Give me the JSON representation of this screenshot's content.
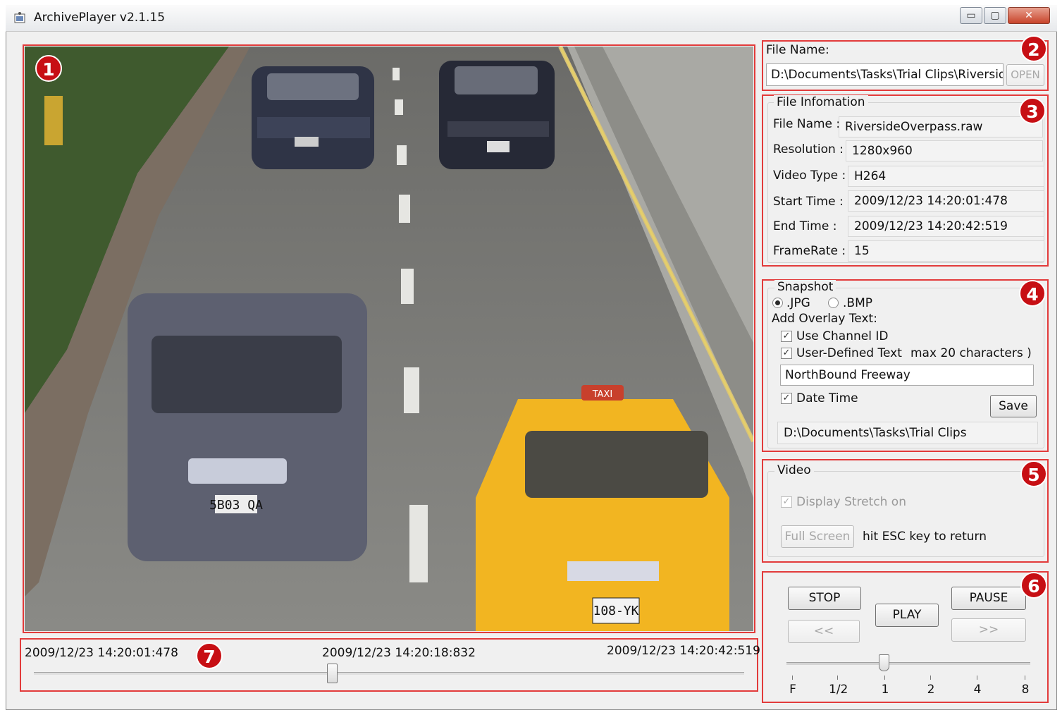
{
  "window": {
    "title": "ArchivePlayer v2.1.15"
  },
  "badges": [
    "1",
    "2",
    "3",
    "4",
    "5",
    "6",
    "7"
  ],
  "file_name": {
    "label": "File Name:",
    "value": "D:\\Documents\\Tasks\\Trial Clips\\RiversideC",
    "open_button": "OPEN"
  },
  "file_info": {
    "title": "File Infomation",
    "rows": [
      {
        "label": "File Name :",
        "value": "RiversideOverpass.raw"
      },
      {
        "label": "Resolution :",
        "value": "1280x960"
      },
      {
        "label": "Video Type :",
        "value": "H264"
      },
      {
        "label": "Start Time :",
        "value": "2009/12/23 14:20:01:478"
      },
      {
        "label": "End Time :",
        "value": "2009/12/23 14:20:42:519"
      },
      {
        "label": "FrameRate :",
        "value": "15"
      }
    ]
  },
  "snapshot": {
    "title": "Snapshot",
    "format_jpg": ".JPG",
    "format_bmp": ".BMP",
    "selected_format": "JPG",
    "overlay_label": "Add Overlay Text:",
    "use_channel_id": "Use Channel ID",
    "user_defined_text": "User-Defined Text",
    "max_chars_note": "max 20 characters )",
    "overlay_value": "NorthBound Freeway",
    "date_time": "Date Time",
    "save_button": "Save",
    "save_path": "D:\\Documents\\Tasks\\Trial Clips"
  },
  "video": {
    "title": "Video",
    "display_stretch": "Display Stretch on",
    "full_screen_button": "Full Screen",
    "esc_hint": "hit ESC key to return"
  },
  "playback": {
    "stop": "STOP",
    "play": "PLAY",
    "pause": "PAUSE",
    "rewind": "<<",
    "forward": ">>",
    "speed_labels": [
      "F",
      "1/2",
      "1",
      "2",
      "4",
      "8"
    ],
    "selected_speed": "1"
  },
  "timeline": {
    "start": "2009/12/23 14:20:01:478",
    "current": "2009/12/23 14:20:18:832",
    "end": "2009/12/23 14:20:42:519",
    "position_fraction": 0.42
  },
  "video_frame": {
    "plates": [
      "5B03 QA",
      "108-YK"
    ],
    "taxi_sign": "TAXI"
  },
  "colors": {
    "badge": "#c70f14",
    "annotation_box": "#e23b3b",
    "taxi": "#f2b521"
  }
}
